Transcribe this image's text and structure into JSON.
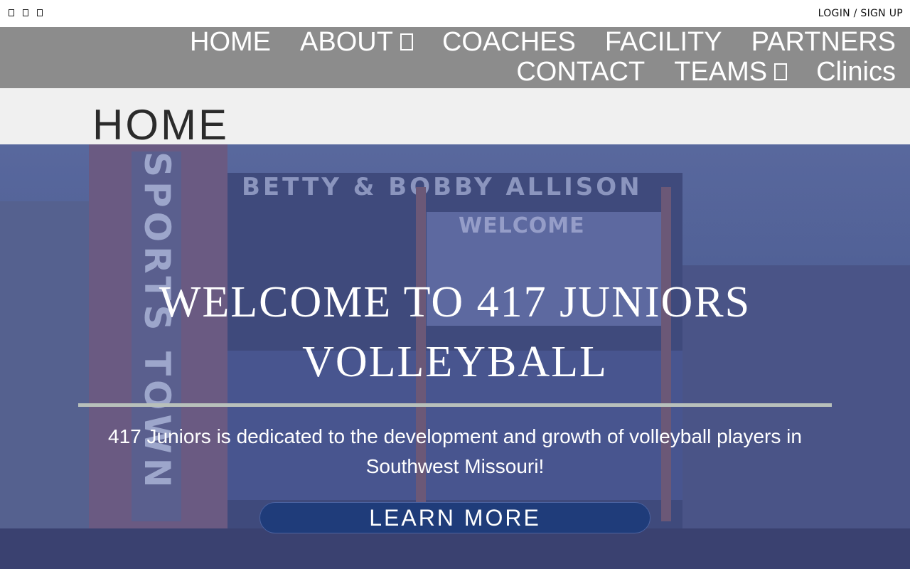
{
  "topbar": {
    "social_icons": [
      "facebook-icon",
      "twitter-icon",
      "instagram-icon"
    ],
    "login_label": "LOGIN / SIGN UP"
  },
  "nav": {
    "items": [
      {
        "label": "HOME",
        "has_dropdown": false
      },
      {
        "label": "ABOUT",
        "has_dropdown": true
      },
      {
        "label": "COACHES",
        "has_dropdown": false
      },
      {
        "label": "FACILITY",
        "has_dropdown": false
      },
      {
        "label": "PARTNERS",
        "has_dropdown": false
      },
      {
        "label": "CONTACT",
        "has_dropdown": false
      },
      {
        "label": "TEAMS",
        "has_dropdown": true
      },
      {
        "label": "Clinics",
        "has_dropdown": false
      }
    ]
  },
  "page": {
    "title": "HOME"
  },
  "hero": {
    "background_sign": "BETTY & BOBBY ALLISON",
    "background_tower": "SPORTS TOWN",
    "background_screen": "WELCOME",
    "title": "WELCOME TO 417 JUNIORS VOLLEYBALL",
    "text": "417 Juniors is dedicated to the development and growth of volleyball players in Southwest Missouri!",
    "cta_label": "LEARN MORE"
  },
  "colors": {
    "nav_bg": "#8c8c8c",
    "title_band_bg": "#f0f0f0",
    "cta_bg": "#1f3c7a",
    "hero_overlay": "#4a5a8f"
  }
}
